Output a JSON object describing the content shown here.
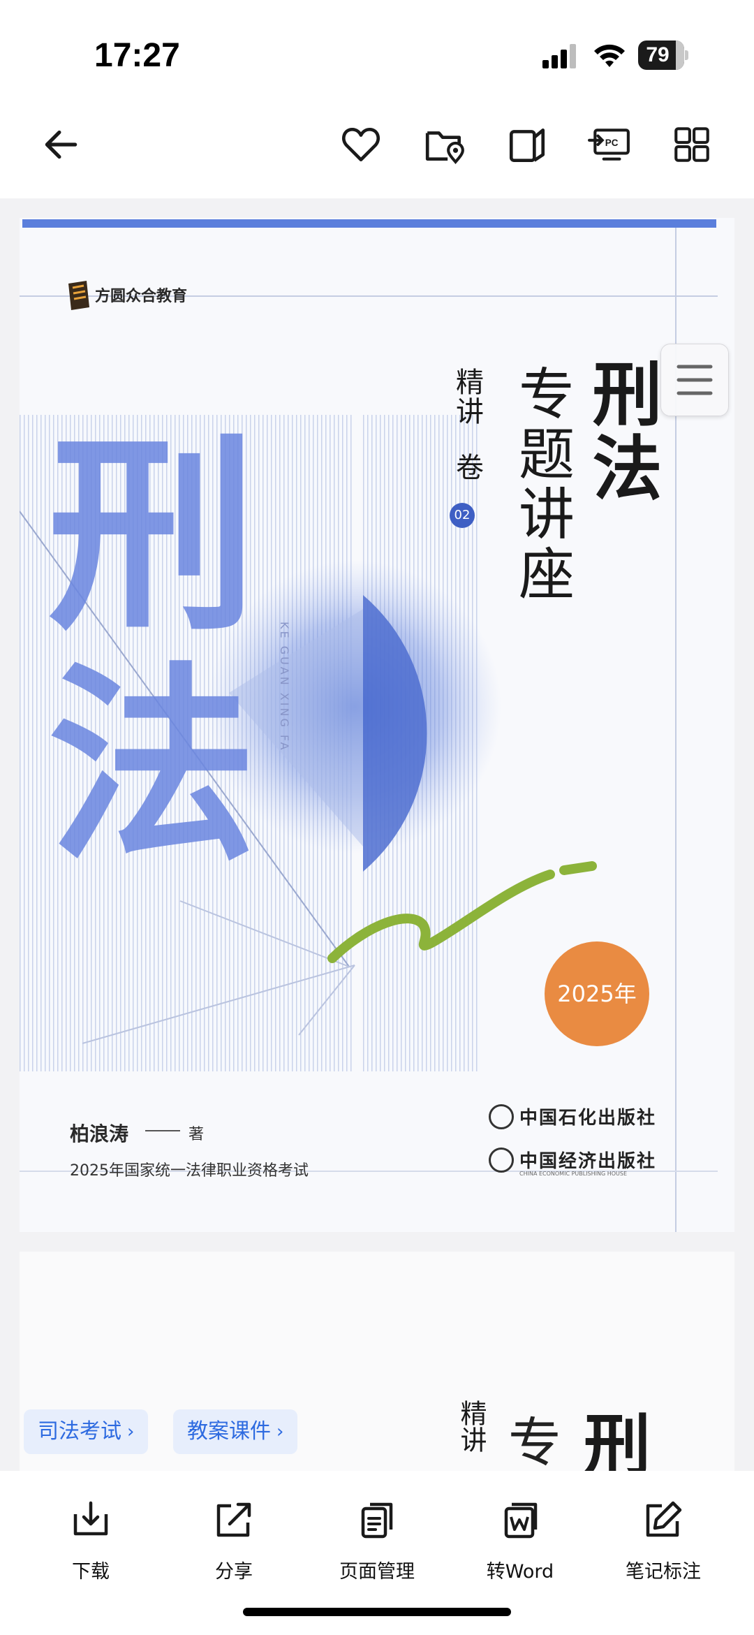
{
  "status_bar": {
    "time": "17:27",
    "battery": "79"
  },
  "toolbar": {
    "icons": [
      "back-arrow-icon",
      "heart-icon",
      "folder-location-icon",
      "page-split-icon",
      "send-to-pc-icon",
      "grid-apps-icon"
    ],
    "pc_label": "PC"
  },
  "cover": {
    "brand": "方圆众合教育",
    "bg_characters": "刑法",
    "title_main": "刑法",
    "title_sub": "专题讲座",
    "series_jing": "精讲",
    "series_juan": "卷",
    "volume": "02",
    "pinyin": "KE GUAN XING FA",
    "year_badge": "2025年",
    "author": "柏浪涛",
    "author_role": "著",
    "exam_line": "2025年国家统一法律职业资格考试",
    "publisher_1": "中国石化出版社",
    "publisher_2": "中国经济出版社",
    "publisher_2_en": "CHINA ECONOMIC PUBLISHING HOUSE",
    "colors": {
      "blue": "#4a6fd6",
      "orange": "#e98b42",
      "green": "#8cb33a"
    }
  },
  "page2": {
    "title_main_partial": "刑",
    "title_sub_partial": "专",
    "series_jing": "精讲"
  },
  "tags": [
    {
      "label": "司法考试"
    },
    {
      "label": "教案课件"
    }
  ],
  "bottom_bar": {
    "download": "下载",
    "share": "分享",
    "page_manage": "页面管理",
    "to_word": "转Word",
    "notes": "笔记标注"
  }
}
